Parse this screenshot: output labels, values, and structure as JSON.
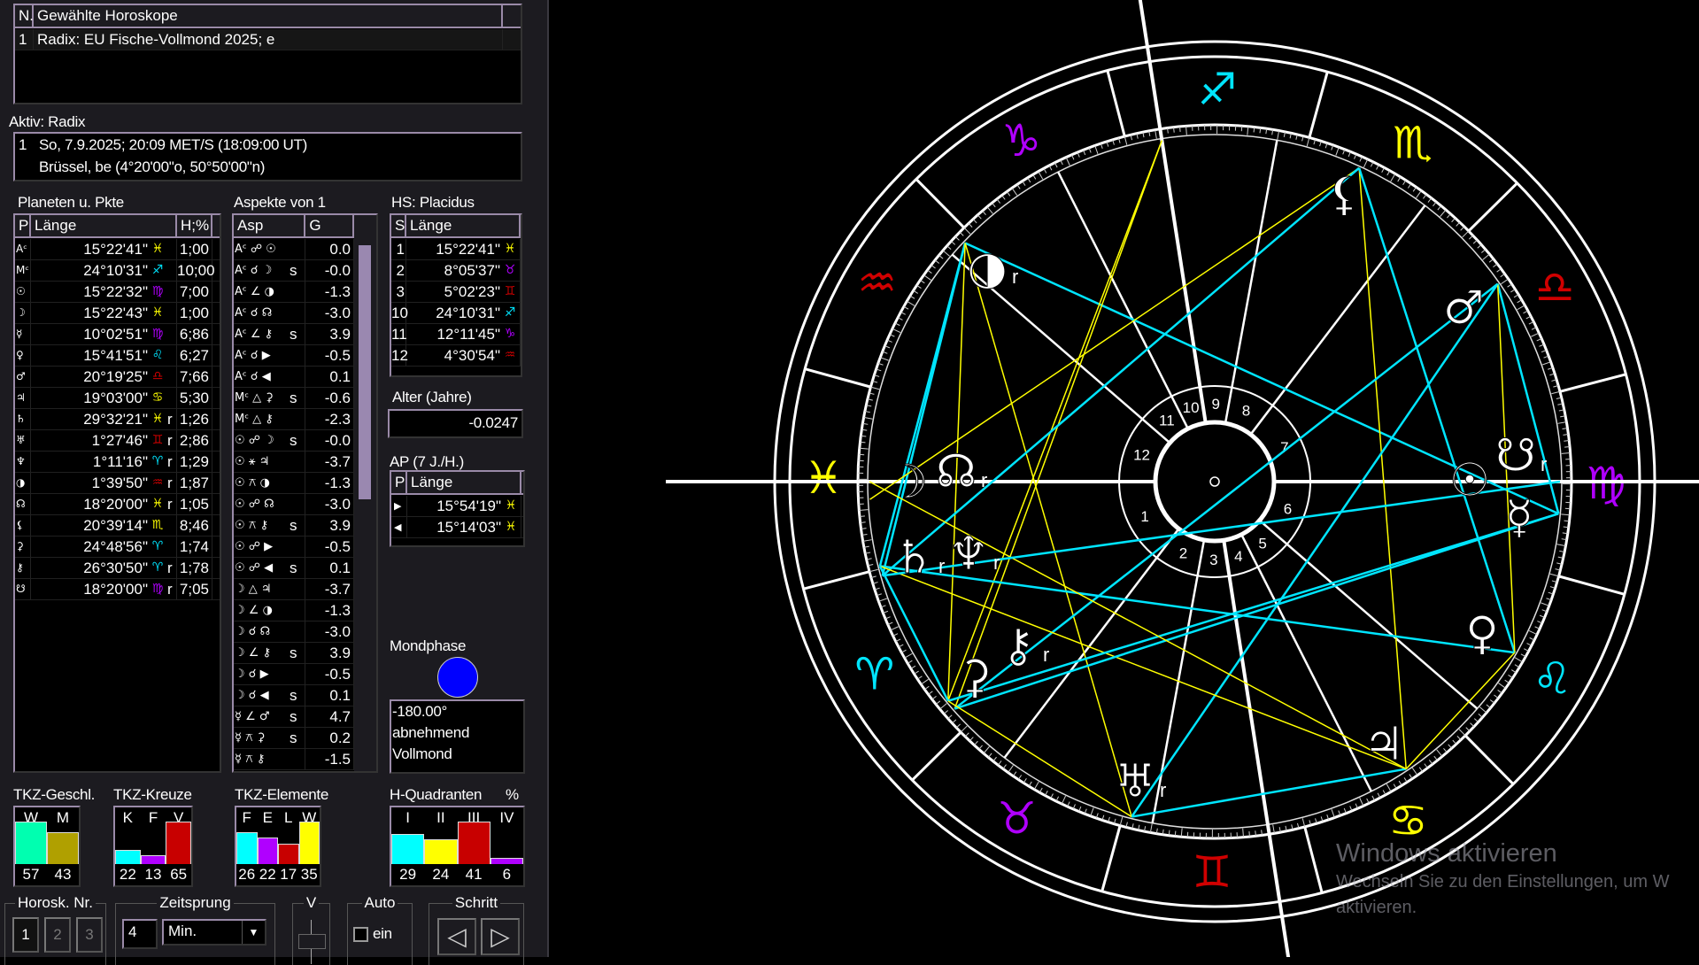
{
  "selected": {
    "col_n": "N.",
    "col_title": "Gewählte Horoskope",
    "rows": [
      {
        "n": "1",
        "title": "Radix: EU Fische-Vollmond 2025; e"
      }
    ]
  },
  "active": {
    "label": "Aktiv: Radix",
    "n": "1",
    "line1": "So, 7.9.2025; 20:09 MET/S (18:09:00 UT)",
    "line2": "Brüssel, be (4°20'00\"o, 50°50'00\"n)"
  },
  "planets": {
    "title": "Planeten u. Pkte",
    "col_p": "P",
    "col_len": "Länge",
    "col_h": "H;%",
    "rows": [
      {
        "p": "Ac",
        "glyph": "Aᶜ",
        "len": "15°22'41\"",
        "sign": "♓",
        "r": "",
        "h": "1;00"
      },
      {
        "p": "Mc",
        "glyph": "Mᶜ",
        "len": "24°10'31\"",
        "sign": "♐",
        "r": "",
        "h": "10;00"
      },
      {
        "p": "Sonne",
        "glyph": "☉",
        "len": "15°22'32\"",
        "sign": "♍",
        "r": "",
        "h": "7;00"
      },
      {
        "p": "Mond",
        "glyph": "☽",
        "len": "15°22'43\"",
        "sign": "♓",
        "r": "",
        "h": "1;00"
      },
      {
        "p": "Merkur",
        "glyph": "☿",
        "len": "10°02'51\"",
        "sign": "♍",
        "r": "",
        "h": "6;86"
      },
      {
        "p": "Venus",
        "glyph": "♀",
        "len": "15°41'51\"",
        "sign": "♌",
        "r": "",
        "h": "6;27"
      },
      {
        "p": "Mars",
        "glyph": "♂",
        "len": "20°19'25\"",
        "sign": "♎",
        "r": "",
        "h": "7;66"
      },
      {
        "p": "Jupiter",
        "glyph": "♃",
        "len": "19°03'00\"",
        "sign": "♋",
        "r": "",
        "h": "5;30"
      },
      {
        "p": "Saturn",
        "glyph": "♄",
        "len": "29°32'21\"",
        "sign": "♓",
        "r": "r",
        "h": "1;26"
      },
      {
        "p": "Uranus",
        "glyph": "♅",
        "len": "1°27'46\"",
        "sign": "♊",
        "r": "r",
        "h": "2;86"
      },
      {
        "p": "Neptun",
        "glyph": "♆",
        "len": "1°11'16\"",
        "sign": "♈",
        "r": "r",
        "h": "1;29"
      },
      {
        "p": "Pluto",
        "glyph": "◑",
        "len": "1°39'50\"",
        "sign": "♒",
        "r": "r",
        "h": "1;87"
      },
      {
        "p": "Mondknoten",
        "glyph": "☊",
        "len": "18°20'00\"",
        "sign": "♓",
        "r": "r",
        "h": "1;05"
      },
      {
        "p": "Lilith",
        "glyph": "⚸",
        "len": "20°39'14\"",
        "sign": "♏",
        "r": "",
        "h": "8;46"
      },
      {
        "p": "Ceres",
        "glyph": "⚳",
        "len": "24°48'56\"",
        "sign": "♈",
        "r": "",
        "h": "1;74"
      },
      {
        "p": "Chiron",
        "glyph": "⚷",
        "len": "26°30'50\"",
        "sign": "♈",
        "r": "r",
        "h": "1;78"
      },
      {
        "p": "Südknoten",
        "glyph": "☋",
        "len": "18°20'00\"",
        "sign": "♍",
        "r": "r",
        "h": "7;05"
      }
    ]
  },
  "aspects": {
    "title": "Aspekte von 1",
    "col_asp": "Asp",
    "col_g": "G",
    "rows": [
      {
        "a": "Aᶜ ☍ ☉",
        "s": "",
        "g": "0.0"
      },
      {
        "a": "Aᶜ ☌ ☽",
        "s": "s",
        "g": "-0.0"
      },
      {
        "a": "Aᶜ ∠ ◑",
        "s": "",
        "g": "-1.3"
      },
      {
        "a": "Aᶜ ☌ ☊",
        "s": "",
        "g": "-3.0"
      },
      {
        "a": "Aᶜ ∠ ⚷",
        "s": "s",
        "g": "3.9"
      },
      {
        "a": "Aᶜ ☌ ▶",
        "s": "",
        "g": "-0.5"
      },
      {
        "a": "Aᶜ ☌ ◀",
        "s": "",
        "g": "0.1"
      },
      {
        "a": "Mᶜ △ ⚳",
        "s": "s",
        "g": "-0.6"
      },
      {
        "a": "Mᶜ △ ⚷",
        "s": "",
        "g": "-2.3"
      },
      {
        "a": "☉ ☍ ☽",
        "s": "s",
        "g": "-0.0"
      },
      {
        "a": "☉ ⚹ ♃",
        "s": "",
        "g": "-3.7"
      },
      {
        "a": "☉ ⚻ ◑",
        "s": "",
        "g": "-1.3"
      },
      {
        "a": "☉ ☍ ☊",
        "s": "",
        "g": "-3.0"
      },
      {
        "a": "☉ ⚻ ⚷",
        "s": "s",
        "g": "3.9"
      },
      {
        "a": "☉ ☍ ▶",
        "s": "",
        "g": "-0.5"
      },
      {
        "a": "☉ ☍ ◀",
        "s": "s",
        "g": "0.1"
      },
      {
        "a": "☽ △ ♃",
        "s": "",
        "g": "-3.7"
      },
      {
        "a": "☽ ∠ ◑",
        "s": "",
        "g": "-1.3"
      },
      {
        "a": "☽ ☌ ☊",
        "s": "",
        "g": "-3.0"
      },
      {
        "a": "☽ ∠ ⚷",
        "s": "s",
        "g": "3.9"
      },
      {
        "a": "☽ ☌ ▶",
        "s": "",
        "g": "-0.5"
      },
      {
        "a": "☽ ☌ ◀",
        "s": "s",
        "g": "0.1"
      },
      {
        "a": "☿ ∠ ♂",
        "s": "s",
        "g": "4.7"
      },
      {
        "a": "☿ ⚻ ⚳",
        "s": "s",
        "g": "0.2"
      },
      {
        "a": "☿ ⚻ ⚷",
        "s": "",
        "g": "-1.5"
      }
    ]
  },
  "houses": {
    "title": "HS: Placidus",
    "col_s": "S",
    "col_len": "Länge",
    "rows": [
      {
        "s": "1",
        "len": "15°22'41\"",
        "sign": "♓"
      },
      {
        "s": "2",
        "len": "8°05'37\"",
        "sign": "♉"
      },
      {
        "s": "3",
        "len": "5°02'23\"",
        "sign": "♊"
      },
      {
        "s": "10",
        "len": "24°10'31\"",
        "sign": "♐"
      },
      {
        "s": "11",
        "len": "12°11'45\"",
        "sign": "♑"
      },
      {
        "s": "12",
        "len": "4°30'54\"",
        "sign": "♒"
      }
    ]
  },
  "age": {
    "label": "Alter (Jahre)",
    "value": "-0.0247"
  },
  "ap": {
    "title": "AP (7 J./H.)",
    "col_p": "P",
    "col_len": "Länge",
    "rows": [
      {
        "p": "▶",
        "len": "15°54'19\"",
        "sign": "♓"
      },
      {
        "p": "◀",
        "len": "15°14'03\"",
        "sign": "♓"
      }
    ]
  },
  "moonphase": {
    "label": "Mondphase",
    "angle": "-180.00°",
    "trend": "abnehmend",
    "phase": "Vollmond",
    "color": "#0000ff"
  },
  "sign_colors": {
    "♈": "#00e5ff",
    "♉": "#b000ff",
    "♊": "#d00000",
    "♋": "#ffff00",
    "♌": "#00e5ff",
    "♍": "#b000ff",
    "♎": "#d00000",
    "♏": "#ffff00",
    "♐": "#00e5ff",
    "♑": "#b000ff",
    "♒": "#d00000",
    "♓": "#ffff00"
  },
  "stats": [
    {
      "title": "TKZ-Geschl.",
      "labels": [
        "W",
        "M"
      ],
      "values": [
        57,
        43
      ],
      "colors": [
        "#00ffb0",
        "#b0a000"
      ]
    },
    {
      "title": "TKZ-Kreuze",
      "labels": [
        "K",
        "F",
        "V"
      ],
      "values": [
        22,
        13,
        65
      ],
      "colors": [
        "#00ffff",
        "#b000ff",
        "#c80000"
      ]
    },
    {
      "title": "TKZ-Elemente",
      "labels": [
        "F",
        "E",
        "L",
        "W"
      ],
      "values": [
        26,
        22,
        17,
        35
      ],
      "colors": [
        "#00ffff",
        "#b000ff",
        "#c80000",
        "#ffff00"
      ]
    },
    {
      "title": "H-Quadranten",
      "unit": "%",
      "labels": [
        "I",
        "II",
        "III",
        "IV"
      ],
      "values": [
        29,
        24,
        41,
        6
      ],
      "colors": [
        "#00ffff",
        "#ffff00",
        "#c80000",
        "#b000ff"
      ]
    }
  ],
  "controls": {
    "horosk_label": "Horosk. Nr.",
    "horosk_buttons": [
      "1",
      "2",
      "3"
    ],
    "zeitsprung_label": "Zeitsprung",
    "zeitsprung_value": "4",
    "zeitsprung_unit": "Min.",
    "v_label": "V",
    "auto_label": "Auto",
    "auto_checkbox": "ein",
    "auto_checked": false,
    "schritt_label": "Schritt",
    "back": "◁",
    "forward": "▷"
  },
  "wheel": {
    "asc": 345.378,
    "signs": [
      "♈",
      "♉",
      "♊",
      "♋",
      "♌",
      "♍",
      "♎",
      "♏",
      "♐",
      "♑",
      "♒",
      "♓"
    ],
    "cusps": [
      345.378,
      38.094,
      65.04,
      84.175,
      102.196,
      124.515,
      165.378,
      218.094,
      245.04,
      264.175,
      282.196,
      304.515
    ],
    "house_numbers": [
      "1",
      "2",
      "3",
      "4",
      "5",
      "6",
      "7",
      "8",
      "9",
      "10",
      "11",
      "12"
    ],
    "points": {
      "sun": {
        "glyph": "☉",
        "lon": 165.376,
        "r": ""
      },
      "moon": {
        "glyph": "☽",
        "lon": 345.379,
        "r": ""
      },
      "mercury": {
        "glyph": "☿",
        "lon": 160.048,
        "r": ""
      },
      "venus": {
        "glyph": "♀",
        "lon": 135.698,
        "r": ""
      },
      "mars": {
        "glyph": "♂",
        "lon": 200.324,
        "r": ""
      },
      "jupiter": {
        "glyph": "♃",
        "lon": 109.05,
        "r": ""
      },
      "saturn": {
        "glyph": "♄",
        "lon": 359.539,
        "r": "r"
      },
      "uranus": {
        "glyph": "♅",
        "lon": 61.463,
        "r": "r"
      },
      "neptune": {
        "glyph": "♆",
        "lon": 1.188,
        "r": "r"
      },
      "pluto": {
        "glyph": "◑",
        "lon": 301.664,
        "r": "r"
      },
      "node": {
        "glyph": "☊",
        "lon": 348.333,
        "r": "r"
      },
      "lilith": {
        "glyph": "⚸",
        "lon": 230.654,
        "r": ""
      },
      "ceres": {
        "glyph": "⚳",
        "lon": 24.816,
        "r": ""
      },
      "chiron": {
        "glyph": "⚷",
        "lon": 26.514,
        "r": "r"
      },
      "snode": {
        "glyph": "☋",
        "lon": 168.333,
        "r": "r"
      },
      "mc": {
        "glyph": "",
        "lon": 264.175,
        "r": ""
      }
    },
    "aspect_lines": [
      [
        "pluto",
        "mercury",
        "cyan"
      ],
      [
        "pluto",
        "saturn",
        "cyan"
      ],
      [
        "pluto",
        "neptune",
        "cyan"
      ],
      [
        "pluto",
        "ceres",
        "yellow"
      ],
      [
        "pluto",
        "uranus",
        "yellow"
      ],
      [
        "mc",
        "ceres",
        "yellow"
      ],
      [
        "mc",
        "chiron",
        "yellow"
      ],
      [
        "lilith",
        "node",
        "yellow"
      ],
      [
        "lilith",
        "neptune",
        "cyan"
      ],
      [
        "lilith",
        "jupiter",
        "yellow"
      ],
      [
        "lilith",
        "venus",
        "cyan"
      ],
      [
        "mars",
        "mercury",
        "cyan"
      ],
      [
        "mars",
        "uranus",
        "cyan"
      ],
      [
        "mars",
        "venus",
        "yellow"
      ],
      [
        "mars",
        "chiron",
        "cyan"
      ],
      [
        "saturn",
        "venus",
        "cyan"
      ],
      [
        "saturn",
        "jupiter",
        "yellow"
      ],
      [
        "saturn",
        "ceres",
        "cyan"
      ],
      [
        "ceres",
        "mercury",
        "cyan"
      ],
      [
        "chiron",
        "mercury",
        "cyan"
      ],
      [
        "ceres",
        "uranus",
        "yellow"
      ],
      [
        "uranus",
        "jupiter",
        "cyan"
      ],
      [
        "venus",
        "jupiter",
        "yellow"
      ],
      [
        "moon",
        "jupiter",
        "yellow"
      ],
      [
        "neptune",
        "sun",
        "cyan"
      ]
    ]
  },
  "watermark": {
    "title": "Windows aktivieren",
    "line1": "Wechseln Sie zu den Einstellungen, um W",
    "line2": "aktivieren."
  }
}
